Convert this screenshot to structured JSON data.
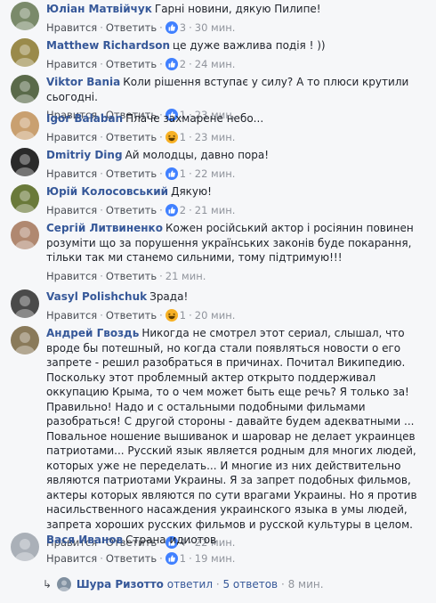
{
  "actions": {
    "like": "Нравится",
    "reply": "Ответить"
  },
  "comments": [
    {
      "author": "Юліан Матвійчук",
      "text": "Гарні новини, дякую Пилипе!",
      "reaction": "like",
      "count": "3",
      "time": "30 мин.",
      "avatar_color": "#7a8a6a"
    },
    {
      "author": "Matthew Richardson",
      "text": "це дуже важлива подія ! ))",
      "reaction": "like",
      "count": "2",
      "time": "24 мин.",
      "avatar_color": "#9a8a4a"
    },
    {
      "author": "Viktor Bania",
      "text": "Коли рішення вступає у силу? А то плюси крутили сьогодні.",
      "reaction": "like",
      "count": "1",
      "time": "23 мин.",
      "avatar_color": "#5a6a4a"
    },
    {
      "author": "Igor Balaban",
      "text": "Плаче захмарене небо...",
      "reaction": "haha",
      "count": "1",
      "time": "23 мин.",
      "avatar_color": "#c9a070"
    },
    {
      "author": "Dmitriy Ding",
      "text": "Ай молодцы, давно пора!",
      "reaction": "like",
      "count": "1",
      "time": "22 мин.",
      "avatar_color": "#2a2a2a"
    },
    {
      "author": "Юрій Колосовський",
      "text": "Дякую!",
      "reaction": "like",
      "count": "2",
      "time": "21 мин.",
      "avatar_color": "#6a7a3a"
    },
    {
      "author": "Сергій Литвиненко",
      "text": "Кожен російський актор і росіянин повинен розуміти що за порушення українських законів буде покарання, тільки так ми станемо сильними, тому підтримую!!!",
      "reaction": "",
      "count": "",
      "time": "21 мин.",
      "avatar_color": "#b08870"
    },
    {
      "author": "Vasyl Polishchuk",
      "text": "Зрада!",
      "reaction": "haha",
      "count": "1",
      "time": "20 мин.",
      "avatar_color": "#4a4a4a"
    },
    {
      "author": "Андрей Гвоздь",
      "text": "Никогда не смотрел этот сериал, слышал, что вроде бы потешный, но когда стали появляться новости о его запрете - решил разобраться в причинах. Почитал Википедию. Поскольку этот проблемный актер открыто поддерживал оккупацию Крыма, то о чем может быть еще речь? Я только за! Правильно! Надо и с остальными подобными фильмами разобраться! С другой стороны - давайте будем адекватными ... Повальное ношение вышиванок и шаровар не делает украинцев патриотами... Русский язык является родным для многих людей, которых уже не переделать... И многие из них действительно являются патриотами Украины. Я за запрет подобных фильмов, актеры которых являются по сути врагами Украины. Но я против насильственного насаждения украинского языка в умы людей, запрета хороших русских фильмов и русской культуры в целом.",
      "reaction": "like",
      "count": "4",
      "time": "22 мин.",
      "avatar_color": "#8a7a5a"
    },
    {
      "author": "Вася Иванов",
      "text": "Страна идиотов",
      "reaction": "like",
      "count": "1",
      "time": "19 мин.",
      "avatar_color": "#aab0b8"
    }
  ],
  "replies": {
    "author": "Шура Ризотто",
    "action": "ответил",
    "count": "5 ответов",
    "time": "8 мин.",
    "avatar_color": "#8090a0"
  },
  "colors": {
    "link": "#365899",
    "muted": "#90949c",
    "like": "#4080ff",
    "haha": "#f7b125",
    "background": "#f6f7f9"
  }
}
